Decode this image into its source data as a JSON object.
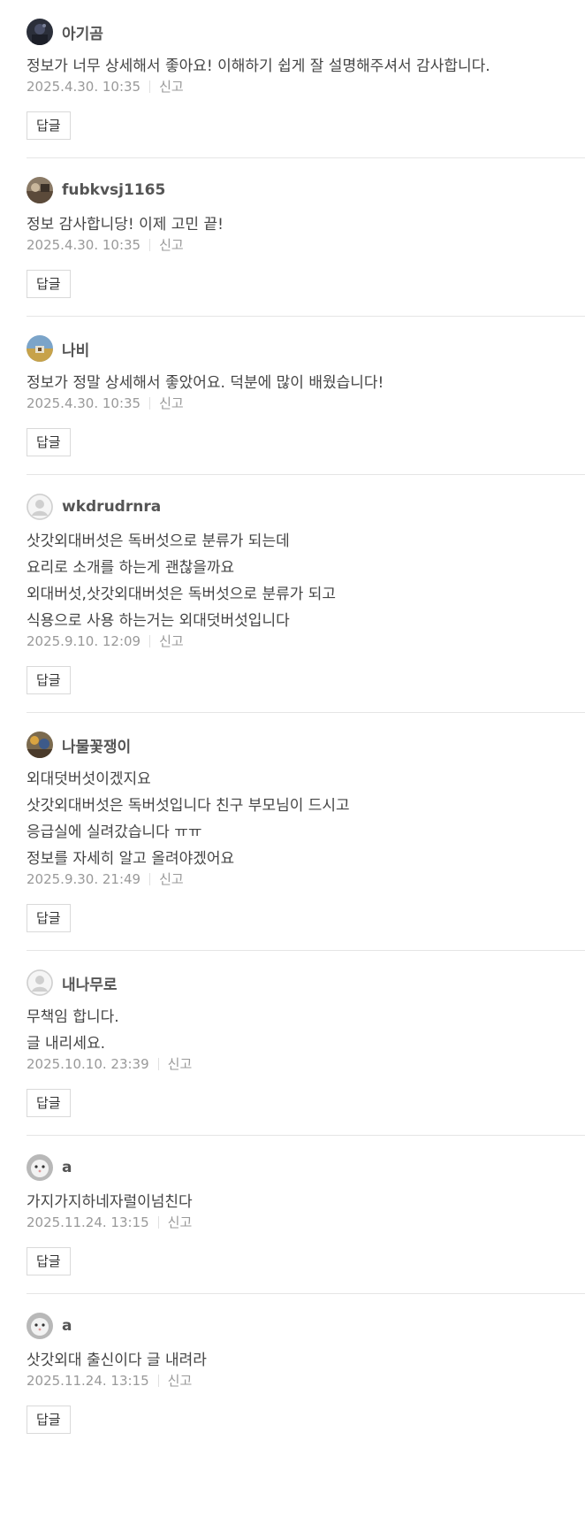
{
  "comments": [
    {
      "author": "아기곰",
      "avatar": "photo-avatar-dark",
      "lines": [
        "정보가 너무 상세해서 좋아요! 이해하기 쉽게 잘 설명해주셔서 감사합니다."
      ],
      "date": "2025.4.30. 10:35",
      "report_label": "신고",
      "reply_label": "답글"
    },
    {
      "author": "fubkvsj1165",
      "avatar": "photo-avatar-brown",
      "lines": [
        "정보 감사합니당! 이제 고민 끝!"
      ],
      "date": "2025.4.30. 10:35",
      "report_label": "신고",
      "reply_label": "답글"
    },
    {
      "author": "나비",
      "avatar": "photo-avatar-landscape",
      "lines": [
        "정보가 정말 상세해서 좋았어요. 덕분에 많이 배웠습니다!"
      ],
      "date": "2025.4.30. 10:35",
      "report_label": "신고",
      "reply_label": "답글"
    },
    {
      "author": "wkdrudrnra",
      "avatar": "default-avatar",
      "lines": [
        "삿갓외대버섯은 독버섯으로 분류가 되는데",
        "요리로 소개를 하는게 괜찮을까요",
        "외대버섯,삿갓외대버섯은 독버섯으로 분류가 되고",
        "식용으로 사용 하는거는 외대덧버섯입니다"
      ],
      "date": "2025.9.10. 12:09",
      "report_label": "신고",
      "reply_label": "답글"
    },
    {
      "author": "나물꽃쟁이",
      "avatar": "photo-avatar-flowers",
      "lines": [
        "외대덧버섯이겠지요",
        "삿갓외대버섯은 독버섯입니다 친구 부모님이 드시고",
        "응급실에 실려갔습니다 ㅠㅠ",
        "정보를 자세히 알고 올려야겠어요"
      ],
      "date": "2025.9.30. 21:49",
      "report_label": "신고",
      "reply_label": "답글"
    },
    {
      "author": "내나무로",
      "avatar": "default-avatar",
      "lines": [
        "무책임 합니다.",
        "글 내리세요."
      ],
      "date": "2025.10.10. 23:39",
      "report_label": "신고",
      "reply_label": "답글"
    },
    {
      "author": "a",
      "avatar": "photo-avatar-white-animal",
      "lines": [
        "가지가지하네자럴이넘친다"
      ],
      "date": "2025.11.24. 13:15",
      "report_label": "신고",
      "reply_label": "답글"
    },
    {
      "author": "a",
      "avatar": "photo-avatar-white-animal",
      "lines": [
        "삿갓외대 출신이다 글 내려라"
      ],
      "date": "2025.11.24. 13:15",
      "report_label": "신고",
      "reply_label": "답글"
    }
  ]
}
